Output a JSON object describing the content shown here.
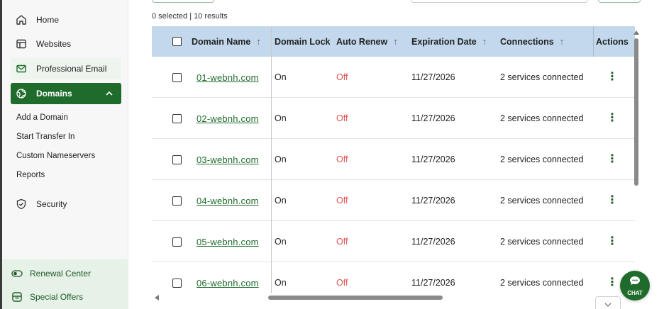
{
  "sidebar": {
    "items": [
      {
        "label": "Home",
        "icon": "home-icon"
      },
      {
        "label": "Websites",
        "icon": "browser-window-icon"
      },
      {
        "label": "Professional Email",
        "icon": "mail-icon"
      },
      {
        "label": "Domains",
        "icon": "globe-icon",
        "active": true
      }
    ],
    "subitems": [
      "Add a Domain",
      "Start Transfer In",
      "Custom Nameservers",
      "Reports"
    ],
    "security_label": "Security",
    "renewal_label": "Renewal Center",
    "offers_label": "Special Offers"
  },
  "main": {
    "results_text": "0 selected | 10 results",
    "headers": {
      "domain": "Domain Name",
      "lock": "Domain Lock",
      "renew": "Auto Renew",
      "expiration": "Expiration Date",
      "connections": "Connections",
      "actions": "Actions"
    },
    "rows": [
      {
        "domain": "01-webnh.com",
        "lock": "On",
        "renew": "Off",
        "expiration": "11/27/2026",
        "connections": "2 services connected"
      },
      {
        "domain": "02-webnh.com",
        "lock": "On",
        "renew": "Off",
        "expiration": "11/27/2026",
        "connections": "2 services connected"
      },
      {
        "domain": "03-webnh.com",
        "lock": "On",
        "renew": "Off",
        "expiration": "11/27/2026",
        "connections": "2 services connected"
      },
      {
        "domain": "04-webnh.com",
        "lock": "On",
        "renew": "Off",
        "expiration": "11/27/2026",
        "connections": "2 services connected"
      },
      {
        "domain": "05-webnh.com",
        "lock": "On",
        "renew": "Off",
        "expiration": "11/27/2026",
        "connections": "2 services connected"
      },
      {
        "domain": "06-webnh.com",
        "lock": "On",
        "renew": "Off",
        "expiration": "11/27/2026",
        "connections": "2 services connected"
      }
    ],
    "chat_label": "CHAT"
  },
  "colors": {
    "brand_green": "#1f6b2c",
    "header_blue": "#c3d8ec",
    "off_red": "#e05656"
  }
}
